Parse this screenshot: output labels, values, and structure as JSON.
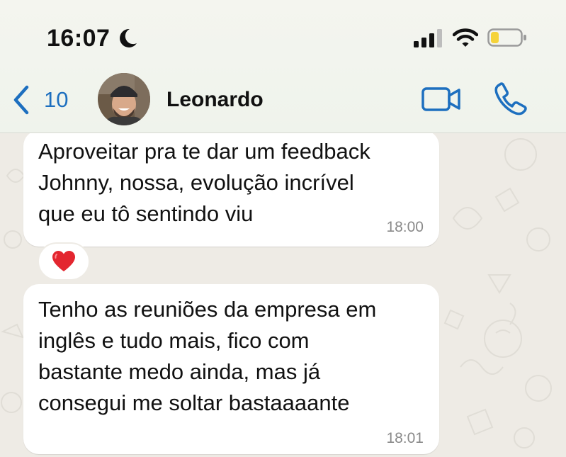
{
  "status_bar": {
    "time": "16:07",
    "icons": [
      "moon-icon",
      "signal-icon",
      "wifi-icon",
      "battery-icon"
    ],
    "battery_color": "#f5d33a"
  },
  "header": {
    "back_count": "10",
    "contact_name": "Leonardo",
    "accent_color": "#1d6fbf",
    "icons": [
      "chevron-left-icon",
      "video-camera-icon",
      "phone-icon"
    ]
  },
  "messages": [
    {
      "text": "Aproveitar pra te dar um feedback\nJohnny, nossa, evolução incrível\nque eu tô sentindo viu",
      "time": "18:00",
      "reaction": "heart-icon"
    },
    {
      "text": "Tenho as reuniões da empresa em\ninglês e tudo mais, fico com\nbastante medo ainda, mas já\nconsegui me soltar bastaaaante",
      "time": "18:01"
    }
  ],
  "colors": {
    "chat_background": "#eeebe5",
    "bubble": "#ffffff",
    "header_background": "#f1f4ed",
    "reaction_heart": "#e3262f"
  }
}
